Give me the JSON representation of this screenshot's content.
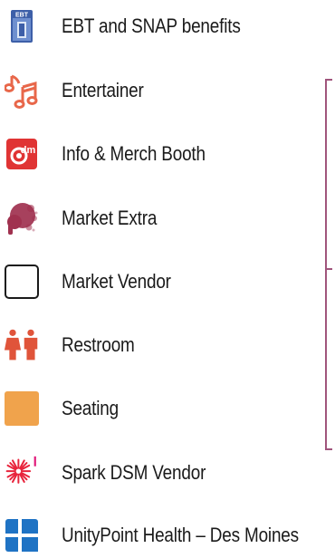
{
  "legend": {
    "items": [
      {
        "label": "EBT and SNAP benefits",
        "icon": "ebt-card-icon"
      },
      {
        "label": "Entertainer",
        "icon": "music-notes-icon"
      },
      {
        "label": "Info & Merch Booth",
        "icon": "info-booth-icon"
      },
      {
        "label": "Market Extra",
        "icon": "paint-splat-icon"
      },
      {
        "label": "Market Vendor",
        "icon": "vendor-square-icon"
      },
      {
        "label": "Restroom",
        "icon": "restroom-icon"
      },
      {
        "label": "Seating",
        "icon": "seating-square-icon"
      },
      {
        "label": "Spark DSM Vendor",
        "icon": "spark-burst-icon"
      },
      {
        "label": "UnityPoint Health – Des Moines",
        "icon": "unitypoint-cross-icon"
      }
    ],
    "ebt_badge_text": "EBT",
    "info_badge_text": "dm"
  },
  "colors": {
    "entertainer": "#e8674a",
    "info_booth": "#e03434",
    "market_extra": "#a0314f",
    "restroom": "#e0543a",
    "seating": "#f0a34c",
    "spark": "#e8243c",
    "unitypoint": "#1f73c4",
    "ebt": "#3d5fa8",
    "bracket": "#a0557c"
  }
}
